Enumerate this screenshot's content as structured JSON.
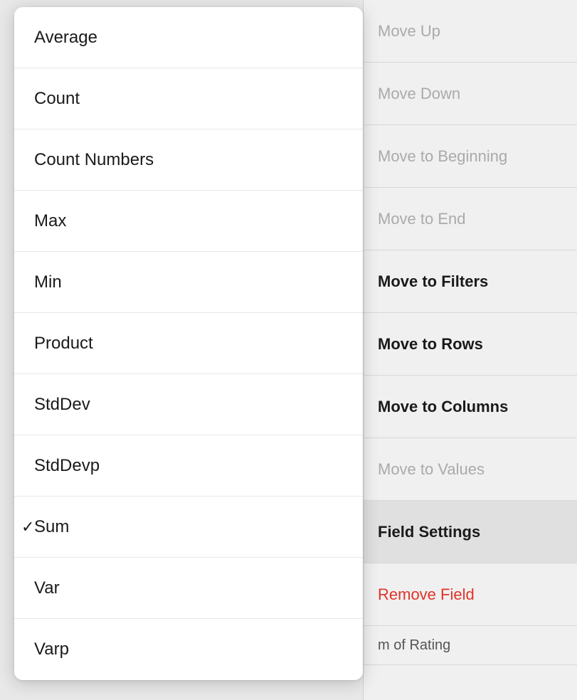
{
  "rightMenu": {
    "items": [
      {
        "id": "move-up",
        "label": "Move Up",
        "style": "grayed",
        "active": false
      },
      {
        "id": "move-down",
        "label": "Move Down",
        "style": "grayed",
        "active": false
      },
      {
        "id": "move-to-beginning",
        "label": "Move to Beginning",
        "style": "grayed",
        "active": false
      },
      {
        "id": "move-to-end",
        "label": "Move to End",
        "style": "grayed",
        "active": false
      },
      {
        "id": "move-to-filters",
        "label": "Move to Filters",
        "style": "bold",
        "active": false
      },
      {
        "id": "move-to-rows",
        "label": "Move to Rows",
        "style": "bold",
        "active": false
      },
      {
        "id": "move-to-columns",
        "label": "Move to Columns",
        "style": "bold",
        "active": false
      },
      {
        "id": "move-to-values",
        "label": "Move to Values",
        "style": "grayed",
        "active": false
      },
      {
        "id": "field-settings",
        "label": "Field Settings",
        "style": "bold",
        "active": true
      },
      {
        "id": "remove-field",
        "label": "Remove Field",
        "style": "red",
        "active": false
      },
      {
        "id": "sum-of-rating",
        "label": "m of Rating",
        "style": "bottom",
        "active": false
      }
    ]
  },
  "leftMenu": {
    "items": [
      {
        "id": "average",
        "label": "Average",
        "checked": false
      },
      {
        "id": "count",
        "label": "Count",
        "checked": false
      },
      {
        "id": "count-numbers",
        "label": "Count Numbers",
        "checked": false
      },
      {
        "id": "max",
        "label": "Max",
        "checked": false
      },
      {
        "id": "min",
        "label": "Min",
        "checked": false
      },
      {
        "id": "product",
        "label": "Product",
        "checked": false
      },
      {
        "id": "stddev",
        "label": "StdDev",
        "checked": false
      },
      {
        "id": "stddevp",
        "label": "StdDevp",
        "checked": false
      },
      {
        "id": "sum",
        "label": "Sum",
        "checked": true
      },
      {
        "id": "var",
        "label": "Var",
        "checked": false
      },
      {
        "id": "varp",
        "label": "Varp",
        "checked": false
      }
    ]
  }
}
